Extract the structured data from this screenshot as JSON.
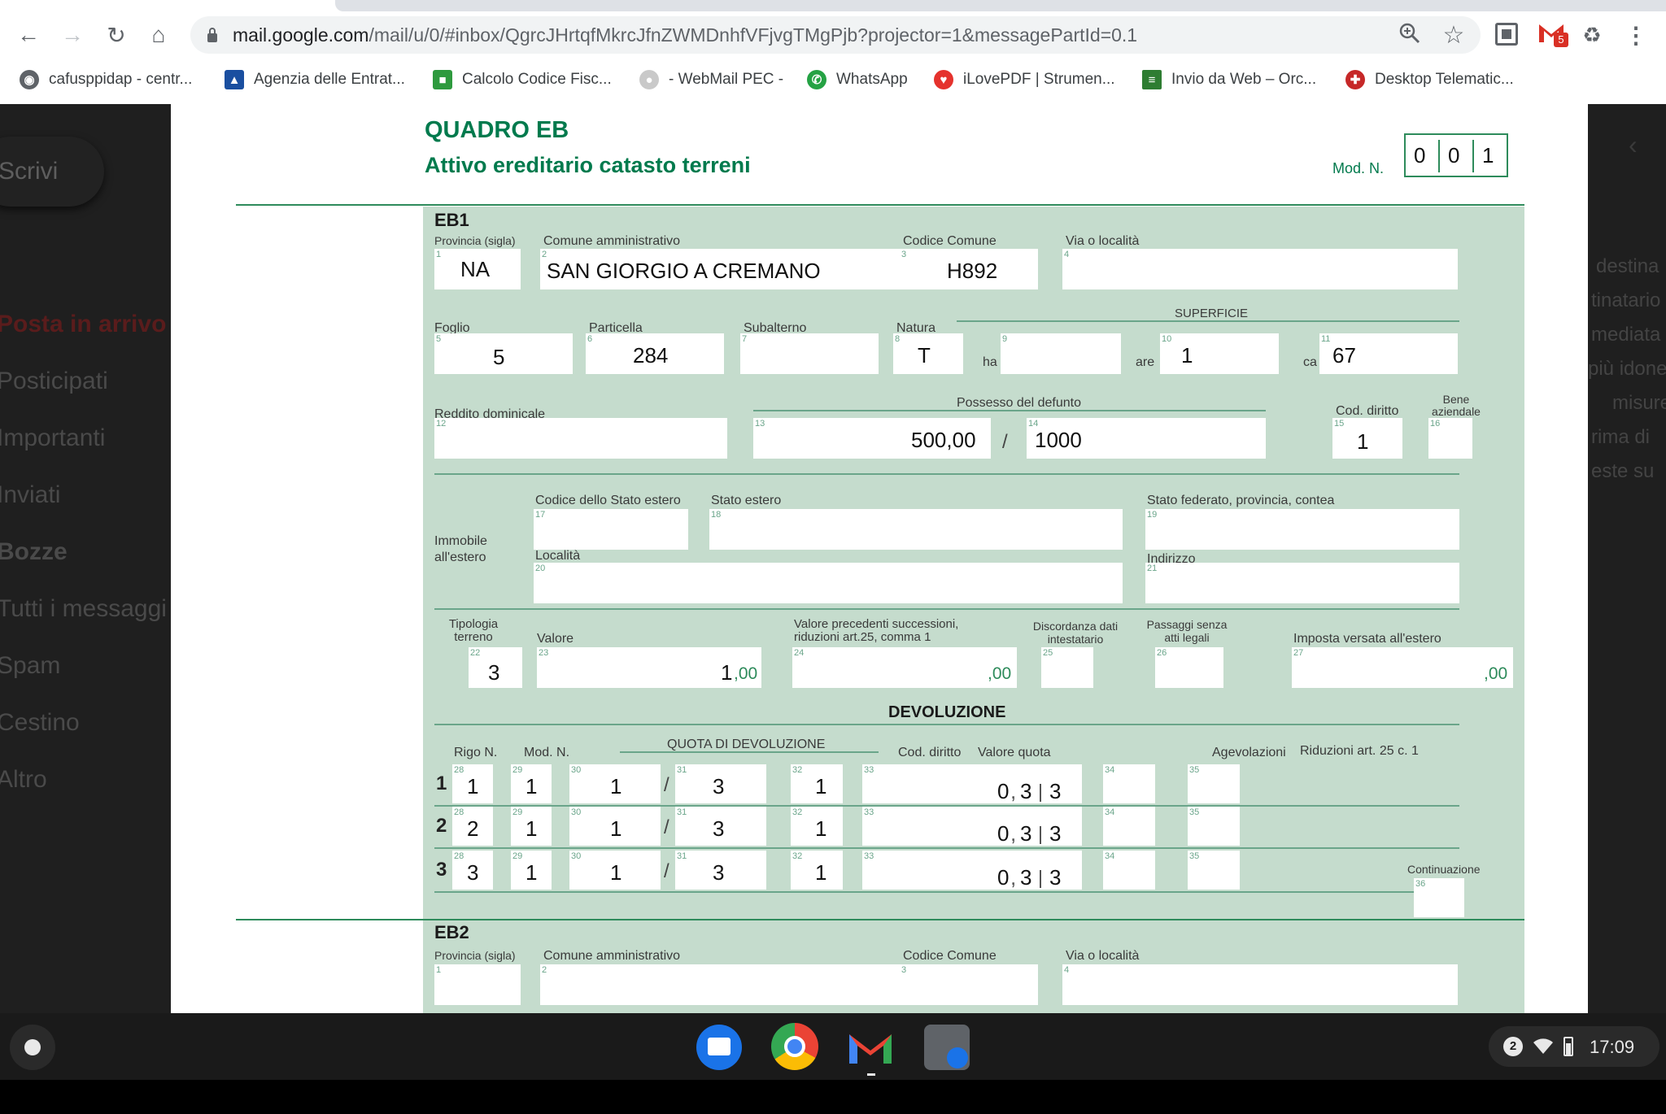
{
  "browser": {
    "url_domain": "mail.google.com",
    "url_path": "/mail/u/0/#inbox/QgrcJHrtqfMkrcJfnZWMDnhfVFjvgTMgPjb?projector=1&messagePartId=0.1",
    "extension_badge": "5"
  },
  "bookmarks": [
    "cafusppidap - centr...",
    "Agenzia delle Entrat...",
    "Calcolo Codice Fisc...",
    "- WebMail PEC -",
    "WhatsApp",
    "iLovePDF | Strumen...",
    "Invio da Web – Orc...",
    "Desktop Telematic..."
  ],
  "gmail": {
    "compose": "Scrivi",
    "nav": [
      "Posta in arrivo",
      "Posticipati",
      "Importanti",
      "Inviati",
      "Bozze",
      "Tutti i messaggi",
      "Spam",
      "Cestino",
      "Altro"
    ],
    "right_text": [
      "destina",
      "tinatario",
      "mediata",
      "più idone",
      "misure",
      "rima di",
      "este su"
    ]
  },
  "form": {
    "title": "QUADRO EB",
    "subtitle": "Attivo ereditario catasto terreni",
    "mod_label": "Mod. N.",
    "mod_digits": [
      "0",
      "0",
      "1"
    ],
    "eb1": {
      "section": "EB1",
      "provincia_label": "Provincia (sigla)",
      "provincia": "NA",
      "comune_label": "Comune amministrativo",
      "comune": "SAN GIORGIO A CREMANO",
      "codice_comune_label": "Codice Comune",
      "codice_comune": "H892",
      "via_label": "Via o località",
      "via": "",
      "foglio_label": "Foglio",
      "foglio": "5",
      "particella_label": "Particella",
      "particella": "284",
      "subalterno_label": "Subalterno",
      "subalterno": "",
      "natura_label": "Natura",
      "natura": "T",
      "superficie_label": "SUPERFICIE",
      "ha_label": "ha",
      "ha": "",
      "are_label": "are",
      "are": "1",
      "ca_label": "ca",
      "ca": "67",
      "reddito_label": "Reddito dominicale",
      "reddito": "",
      "possesso_label": "Possesso del defunto",
      "possesso_num": "500,00",
      "possesso_slash": "/",
      "possesso_den": "1000",
      "cod_diritto_label": "Cod. diritto",
      "cod_diritto": "1",
      "bene_label": "Bene aziendale",
      "bene": "",
      "estero_label": "Immobile all'estero",
      "codice_stato_label": "Codice dello Stato estero",
      "stato_estero_label": "Stato estero",
      "stato_federato_label": "Stato federato, provincia, contea",
      "localita_label": "Località",
      "indirizzo_label": "Indirizzo",
      "tipologia_label": "Tipologia terreno",
      "tipologia": "3",
      "valore_label": "Valore",
      "valore": "1",
      "valore_dec": ",00",
      "valore_prec_label": "Valore precedenti successioni, riduzioni art.25, comma 1",
      "valore_prec_dec": ",00",
      "discordanza_label": "Discordanza dati intestatario",
      "passaggi_label": "Passaggi senza atti legali",
      "imposta_label": "Imposta versata all'estero",
      "imposta_dec": ",00"
    },
    "devoluzione": {
      "title": "DEVOLUZIONE",
      "rigo_label": "Rigo N.",
      "mod_label": "Mod. N.",
      "quota_label": "QUOTA DI DEVOLUZIONE",
      "cod_label": "Cod. diritto",
      "valore_quota_label": "Valore quota",
      "agevolazioni_label": "Agevolazioni",
      "riduzioni_label": "Riduzioni art. 25 c. 1",
      "continuazione_label": "Continuazione",
      "rows": [
        {
          "n": "1",
          "rigo": "1",
          "mod": "1",
          "qnum": "1",
          "qslash": "/",
          "qden": "3",
          "cod": "1",
          "val_a": "0",
          "val_b": "3",
          "val_c": "3"
        },
        {
          "n": "2",
          "rigo": "2",
          "mod": "1",
          "qnum": "1",
          "qslash": "/",
          "qden": "3",
          "cod": "1",
          "val_a": "0",
          "val_b": "3",
          "val_c": "3"
        },
        {
          "n": "3",
          "rigo": "3",
          "mod": "1",
          "qnum": "1",
          "qslash": "/",
          "qden": "3",
          "cod": "1",
          "val_a": "0",
          "val_b": "3",
          "val_c": "3"
        }
      ]
    },
    "eb2": {
      "section": "EB2",
      "provincia_label": "Provincia (sigla)",
      "comune_label": "Comune amministrativo",
      "codice_comune_label": "Codice Comune",
      "via_label": "Via o località"
    }
  },
  "shelf": {
    "time": "17:09",
    "notification_count": "2"
  }
}
